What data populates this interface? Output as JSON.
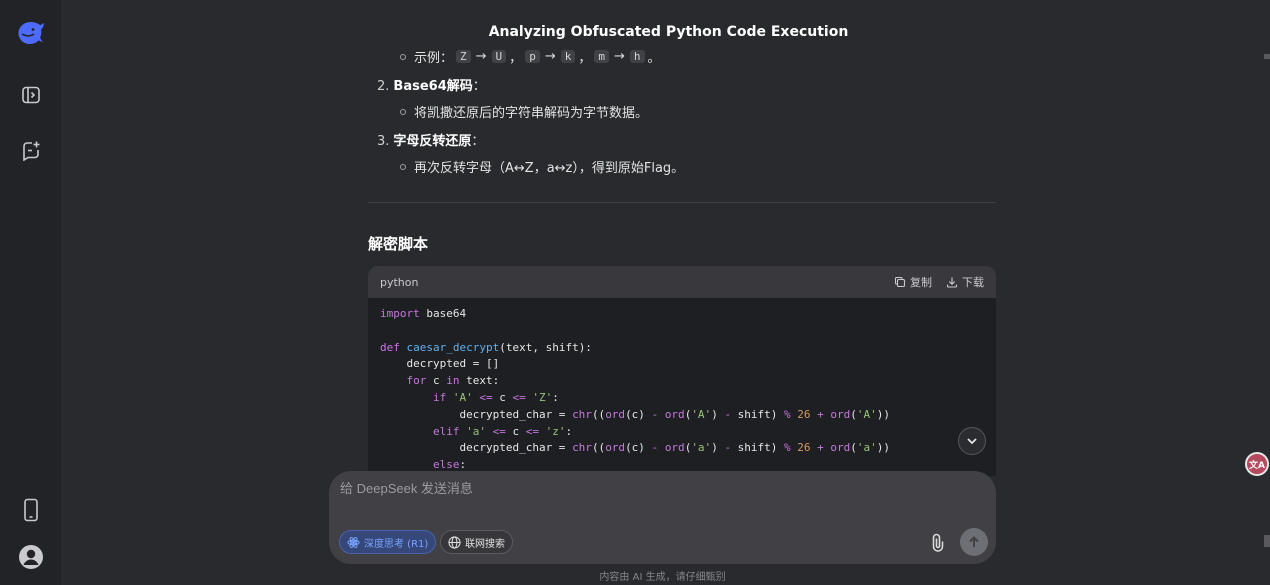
{
  "header": {
    "title": "Analyzing Obfuscated Python Code Execution"
  },
  "content": {
    "example_label": "示例：",
    "example_tokens": [
      "Z",
      "U",
      "p",
      "k",
      "m",
      "h"
    ],
    "example_sep": "，",
    "example_end": "。",
    "arrow": "→",
    "steps": [
      {
        "number": "2.",
        "title": "Base64解码",
        "colon": "：",
        "detail": "将凯撒还原后的字符串解码为字节数据。"
      },
      {
        "number": "3.",
        "title": "字母反转还原",
        "colon": "：",
        "detail": "再次反转字母（A↔Z，a↔z），得到原始Flag。"
      }
    ],
    "section_heading": "解密脚本"
  },
  "code": {
    "language": "python",
    "copy_label": "复制",
    "download_label": "下载",
    "lines": {
      "l1_kw": "import",
      "l1_rest": " base64",
      "l3_kw": "def",
      "l3_fn": "caesar_decrypt",
      "l3_rest": "(text, shift):",
      "l4": "    decrypted = []",
      "l5_a": "    ",
      "l5_kw1": "for",
      "l5_b": " c ",
      "l5_kw2": "in",
      "l5_c": " text:",
      "l6_a": "        ",
      "l6_kw": "if",
      "l6_s1": "'A'",
      "l6_op1": "<=",
      "l6_b": " c ",
      "l6_op2": "<=",
      "l6_s2": "'Z'",
      "l6_c": ":",
      "l7_a": "            decrypted_char = ",
      "l7_f1": "chr",
      "l7_b": "((",
      "l7_f2": "ord",
      "l7_c": "(c) ",
      "l7_op1": "-",
      "l7_f3": "ord",
      "l7_d": "(",
      "l7_s1": "'A'",
      "l7_e": ") ",
      "l7_op2": "-",
      "l7_f": " shift) ",
      "l7_op3": "%",
      "l7_n": "26",
      "l7_op4": "+",
      "l7_f4": "ord",
      "l7_g": "(",
      "l7_s2": "'A'",
      "l7_h": "))",
      "l8_a": "        ",
      "l8_kw": "elif",
      "l8_s1": "'a'",
      "l8_op1": "<=",
      "l8_b": " c ",
      "l8_op2": "<=",
      "l8_s2": "'z'",
      "l8_c": ":",
      "l9_a": "            decrypted_char = ",
      "l9_f1": "chr",
      "l9_b": "((",
      "l9_f2": "ord",
      "l9_c": "(c) ",
      "l9_op1": "-",
      "l9_f3": "ord",
      "l9_d": "(",
      "l9_s1": "'a'",
      "l9_e": ") ",
      "l9_op2": "-",
      "l9_f": " shift) ",
      "l9_op3": "%",
      "l9_n": "26",
      "l9_op4": "+",
      "l9_f4": "ord",
      "l9_g": "(",
      "l9_s2": "'a'",
      "l9_h": "))",
      "l10_a": "        ",
      "l10_kw": "else",
      "l10_c": ":"
    }
  },
  "composer": {
    "placeholder": "给 DeepSeek 发送消息",
    "deep_think_label": "深度思考 (R1)",
    "web_search_label": "联网搜索"
  },
  "footer": {
    "disclaimer": "内容由 AI 生成，请仔细甄别"
  },
  "widgets": {
    "translate_label": "文A"
  },
  "colors": {
    "accent": "#4d6bfe",
    "background": "#292a2d",
    "sidebar": "#212327"
  }
}
